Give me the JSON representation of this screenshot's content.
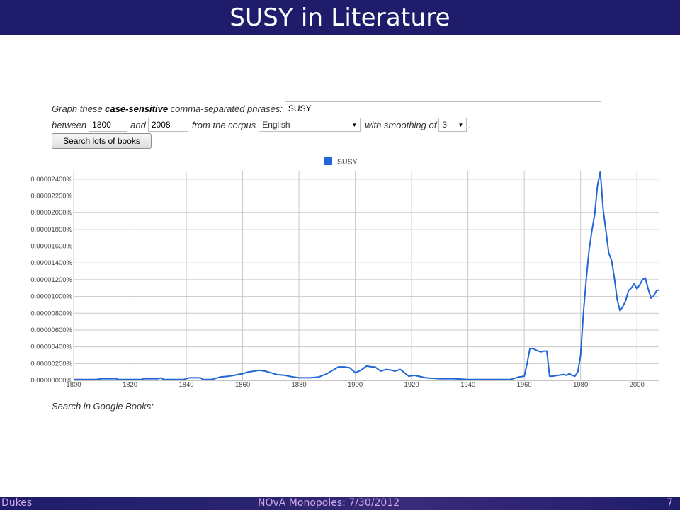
{
  "slide": {
    "title": "SUSY in Literature",
    "footer_left": "Dukes",
    "footer_center": "NOvA Monopoles: 7/30/2012",
    "footer_right": "7"
  },
  "form": {
    "phrases_label_pre": "Graph these ",
    "phrases_label_bold": "case-sensitive",
    "phrases_label_post": " comma-separated phrases:",
    "phrases_value": "SUSY",
    "between_label": "between",
    "start_year": "1800",
    "and_label": "and",
    "end_year": "2008",
    "corpus_label": "from the corpus",
    "corpus_value": "English",
    "smoothing_label": "with smoothing of",
    "smoothing_value": "3",
    "period": ".",
    "search_button": "Search lots of books",
    "search_google_books": "Search in Google Books:"
  },
  "colors": {
    "line": "#2166d6",
    "header_bg": "#1f1d6b",
    "footer_text": "#d0a8e8"
  },
  "chart_data": {
    "type": "line",
    "legend": "top-center",
    "grid": true,
    "xlim": [
      1800,
      2008
    ],
    "ylim": [
      0,
      2.5e-05
    ],
    "x_ticks": [
      "1800",
      "1820",
      "1840",
      "1860",
      "1880",
      "1900",
      "1920",
      "1940",
      "1960",
      "1980",
      "2000"
    ],
    "y_ticks": [
      "0.00000000%",
      "0.00000200%",
      "0.00000400%",
      "0.00000600%",
      "0.00000800%",
      "0.00001000%",
      "0.00001200%",
      "0.00001400%",
      "0.00001600%",
      "0.00001800%",
      "0.00002000%",
      "0.00002200%",
      "0.00002400%"
    ],
    "series": [
      {
        "name": "SUSY",
        "color": "#2166d6",
        "x": [
          1800,
          1808,
          1810,
          1815,
          1816,
          1824,
          1825,
          1830,
          1831,
          1832,
          1839,
          1840,
          1841,
          1845,
          1846,
          1849,
          1852,
          1855,
          1857,
          1860,
          1862,
          1864,
          1866,
          1868,
          1870,
          1872,
          1875,
          1878,
          1880,
          1884,
          1887,
          1890,
          1892,
          1894,
          1896,
          1898,
          1900,
          1902,
          1904,
          1906,
          1907,
          1909,
          1911,
          1913,
          1914,
          1916,
          1919,
          1921,
          1925,
          1930,
          1935,
          1940,
          1945,
          1950,
          1955,
          1958,
          1960,
          1961,
          1962,
          1963,
          1965,
          1966,
          1967,
          1968,
          1969,
          1970,
          1972,
          1974,
          1975,
          1976,
          1977,
          1978,
          1979,
          1980,
          1981,
          1982,
          1983,
          1984,
          1985,
          1986,
          1987,
          1988,
          1989,
          1990,
          1991,
          1992,
          1993,
          1994,
          1995,
          1996,
          1997,
          1998,
          1999,
          2000,
          2001,
          2002,
          2003,
          2004,
          2005,
          2006,
          2007,
          2008
        ],
        "y": [
          1e-07,
          1e-07,
          2e-07,
          2e-07,
          1e-07,
          1e-07,
          2e-07,
          2e-07,
          3e-07,
          1e-07,
          1e-07,
          2e-07,
          3e-07,
          3e-07,
          1e-07,
          1e-07,
          4e-07,
          5e-07,
          6e-07,
          8e-07,
          1e-06,
          1.1e-06,
          1.2e-06,
          1.1e-06,
          9e-07,
          7e-07,
          6e-07,
          4e-07,
          3e-07,
          3e-07,
          4e-07,
          8e-07,
          1.2e-06,
          1.6e-06,
          1.6e-06,
          1.5e-06,
          9e-07,
          1.2e-06,
          1.7e-06,
          1.6e-06,
          1.6e-06,
          1.1e-06,
          1.3e-06,
          1.2e-06,
          1.1e-06,
          1.3e-06,
          5e-07,
          6e-07,
          3e-07,
          2e-07,
          2e-07,
          1e-07,
          1e-07,
          1e-07,
          1e-07,
          4e-07,
          5e-07,
          2e-06,
          3.8e-06,
          3.8e-06,
          3.5e-06,
          3.4e-06,
          3.5e-06,
          3.5e-06,
          5e-07,
          5e-07,
          6e-07,
          7e-07,
          6e-07,
          8e-07,
          6e-07,
          5e-07,
          1e-06,
          3e-06,
          8e-06,
          1.2e-05,
          1.55e-05,
          1.78e-05,
          1.98e-05,
          2.32e-05,
          2.49e-05,
          2.04e-05,
          1.78e-05,
          1.52e-05,
          1.43e-05,
          1.22e-05,
          9.6e-06,
          8.3e-06,
          8.8e-06,
          9.5e-06,
          1.07e-05,
          1.1e-05,
          1.15e-05,
          1.09e-05,
          1.14e-05,
          1.2e-05,
          1.22e-05,
          1.09e-05,
          9.8e-06,
          1.01e-05,
          1.07e-05,
          1.08e-05
        ]
      }
    ]
  }
}
